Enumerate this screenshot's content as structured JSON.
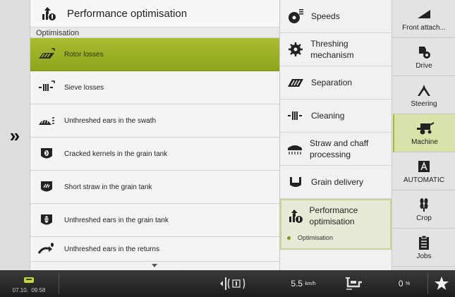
{
  "colors": {
    "accent": "#9db324",
    "selected_nav": "#d7e3a8"
  },
  "main": {
    "title": "Performance optimisation",
    "title_icon": "performance-optimisation-icon",
    "section": "Optimisation",
    "items": [
      {
        "label": "Rotor losses",
        "icon": "rotor-losses-icon",
        "selected": true
      },
      {
        "label": "Sieve losses",
        "icon": "sieve-losses-icon"
      },
      {
        "label": "Unthreshed ears in the swath",
        "icon": "swath-ears-icon"
      },
      {
        "label": "Cracked kernels in the grain tank",
        "icon": "cracked-kernels-icon"
      },
      {
        "label": "Short straw in the grain tank",
        "icon": "short-straw-icon"
      },
      {
        "label": "Unthreshed ears in the grain tank",
        "icon": "tank-ears-icon"
      },
      {
        "label": "Unthreshed ears in the returns",
        "icon": "returns-ears-icon"
      }
    ]
  },
  "categories": [
    {
      "label": "Speeds",
      "icon": "speeds-icon"
    },
    {
      "label": "Threshing mechanism",
      "icon": "threshing-icon"
    },
    {
      "label": "Separation",
      "icon": "separation-icon"
    },
    {
      "label": "Cleaning",
      "icon": "cleaning-icon"
    },
    {
      "label": "Straw and chaff processing",
      "icon": "straw-chaff-icon"
    },
    {
      "label": "Grain delivery",
      "icon": "grain-delivery-icon"
    },
    {
      "label": "Performance optimisation",
      "icon": "performance-optimisation-icon",
      "sub": "Optimisation",
      "active": true
    }
  ],
  "nav": [
    {
      "label": "Front attach...",
      "icon": "front-attachment-icon"
    },
    {
      "label": "Drive",
      "icon": "drive-icon"
    },
    {
      "label": "Steering",
      "icon": "steering-icon"
    },
    {
      "label": "Machine",
      "icon": "machine-icon",
      "active": true
    },
    {
      "label": "AUTOMATIC",
      "icon": "automatic-icon"
    },
    {
      "label": "Crop",
      "icon": "crop-icon"
    },
    {
      "label": "Jobs",
      "icon": "jobs-icon"
    }
  ],
  "status": {
    "date": "07.10.",
    "time": "09:58",
    "speed_value": "5.5",
    "speed_unit": "km/h",
    "percent_value": "0",
    "percent_unit": "%"
  }
}
